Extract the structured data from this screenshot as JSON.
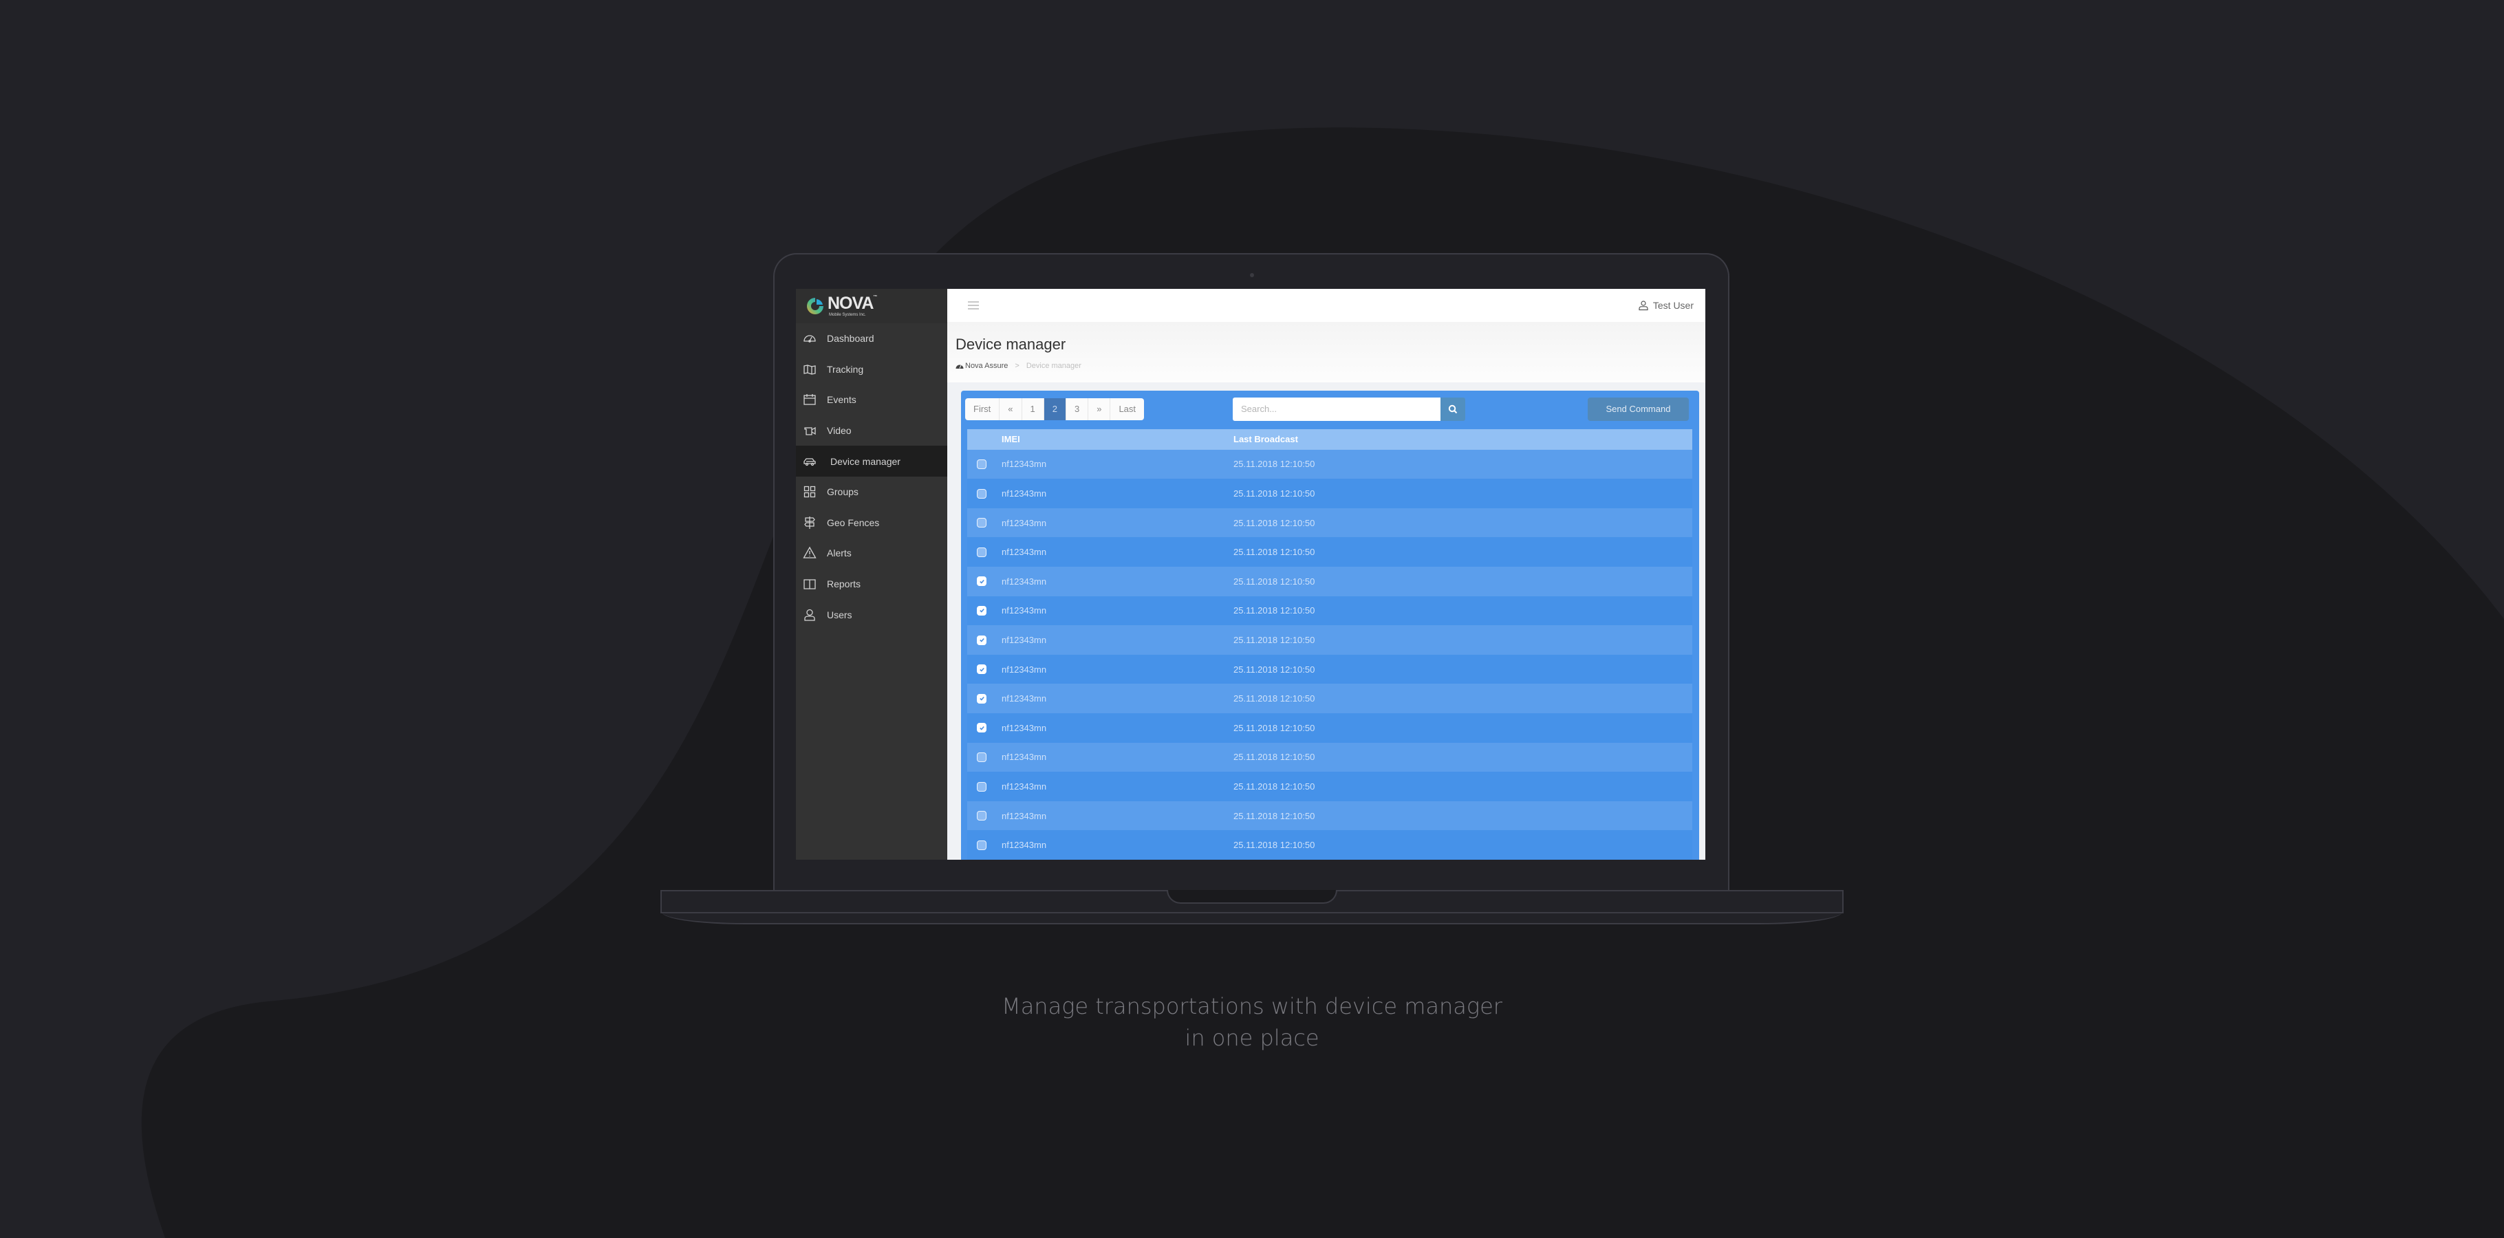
{
  "app": {
    "brand_name": "NOVA",
    "brand_trademark": "™",
    "brand_tagline": "Mobile Systems Inc."
  },
  "sidebar": {
    "items": [
      {
        "label": "Dashboard",
        "icon": "speedometer-icon",
        "active": false
      },
      {
        "label": "Tracking",
        "icon": "map-icon",
        "active": false
      },
      {
        "label": "Events",
        "icon": "calendar-icon",
        "active": false
      },
      {
        "label": "Video",
        "icon": "video-camera-icon",
        "active": false
      },
      {
        "label": "Device manager",
        "icon": "car-icon",
        "active": true
      },
      {
        "label": "Groups",
        "icon": "grid-icon",
        "active": false
      },
      {
        "label": "Geo Fences",
        "icon": "signpost-icon",
        "active": false
      },
      {
        "label": "Alerts",
        "icon": "warning-icon",
        "active": false
      },
      {
        "label": "Reports",
        "icon": "book-icon",
        "active": false
      },
      {
        "label": "Users",
        "icon": "user-icon",
        "active": false
      }
    ]
  },
  "topbar": {
    "user_name": "Test User"
  },
  "page": {
    "title": "Device manager",
    "breadcrumb": {
      "home": "Nova Assure",
      "separator": ">",
      "current": "Device manager"
    }
  },
  "toolbar": {
    "pagination": {
      "first": "First",
      "prev": "«",
      "pages": [
        "1",
        "2",
        "3"
      ],
      "current_page": "2",
      "next": "»",
      "last": "Last"
    },
    "search_placeholder": "Search...",
    "send_command_label": "Send Command"
  },
  "table": {
    "columns": [
      "IMEI",
      "Last Broadcast"
    ],
    "rows": [
      {
        "imei": "nf12343mn",
        "last_broadcast": "25.11.2018 12:10:50",
        "checked": false
      },
      {
        "imei": "nf12343mn",
        "last_broadcast": "25.11.2018 12:10:50",
        "checked": false
      },
      {
        "imei": "nf12343mn",
        "last_broadcast": "25.11.2018 12:10:50",
        "checked": false
      },
      {
        "imei": "nf12343mn",
        "last_broadcast": "25.11.2018 12:10:50",
        "checked": false
      },
      {
        "imei": "nf12343mn",
        "last_broadcast": "25.11.2018 12:10:50",
        "checked": true
      },
      {
        "imei": "nf12343mn",
        "last_broadcast": "25.11.2018 12:10:50",
        "checked": true
      },
      {
        "imei": "nf12343mn",
        "last_broadcast": "25.11.2018 12:10:50",
        "checked": true
      },
      {
        "imei": "nf12343mn",
        "last_broadcast": "25.11.2018 12:10:50",
        "checked": true
      },
      {
        "imei": "nf12343mn",
        "last_broadcast": "25.11.2018 12:10:50",
        "checked": true
      },
      {
        "imei": "nf12343mn",
        "last_broadcast": "25.11.2018 12:10:50",
        "checked": true
      },
      {
        "imei": "nf12343mn",
        "last_broadcast": "25.11.2018 12:10:50",
        "checked": false
      },
      {
        "imei": "nf12343mn",
        "last_broadcast": "25.11.2018 12:10:50",
        "checked": false
      },
      {
        "imei": "nf12343mn",
        "last_broadcast": "25.11.2018 12:10:50",
        "checked": false
      },
      {
        "imei": "nf12343mn",
        "last_broadcast": "25.11.2018 12:10:50",
        "checked": false
      }
    ]
  },
  "caption": {
    "line1": "Manage transportations with device manager",
    "line2": "in one place"
  },
  "colors": {
    "page_background": "#222227",
    "background_shape": "#1a1a1d",
    "sidebar": "#333333",
    "sidebar_active": "#1e1e1e",
    "panel_blue": "#4a94ea",
    "header_row": "#92c0f4",
    "active_page": "#4377b6",
    "send_button": "#5289b9"
  }
}
